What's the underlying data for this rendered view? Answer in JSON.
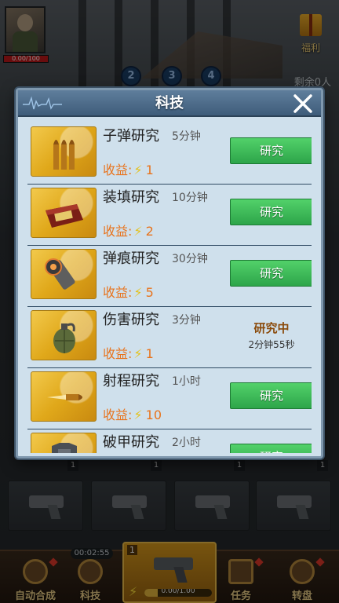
{
  "hud": {
    "hp_text": "0.00/100",
    "gift_label": "福利",
    "waves": [
      "2",
      "3",
      "4"
    ],
    "remain_text": "剩余0人"
  },
  "bottom": {
    "slot_counts": [
      "1",
      "1",
      "1",
      "1"
    ],
    "timer": "00:02:55",
    "center_slot_num": "1",
    "center_progress_text": "0.00/1.00",
    "center_progress": 0.2,
    "nav": [
      "自动合成",
      "科技",
      "任务",
      "转盘"
    ]
  },
  "modal": {
    "title": "科技",
    "rows": [
      {
        "name": "子弹研究",
        "time": "5分钟",
        "yield_label": "收益:",
        "yield_value": "1",
        "action": "研究"
      },
      {
        "name": "装填研究",
        "time": "10分钟",
        "yield_label": "收益:",
        "yield_value": "2",
        "action": "研究"
      },
      {
        "name": "弹痕研究",
        "time": "30分钟",
        "yield_label": "收益:",
        "yield_value": "5",
        "action": "研究"
      },
      {
        "name": "伤害研究",
        "time": "3分钟",
        "yield_label": "收益:",
        "yield_value": "1",
        "status": "研究中",
        "remaining": "2分钟55秒"
      },
      {
        "name": "射程研究",
        "time": "1小时",
        "yield_label": "收益:",
        "yield_value": "10",
        "action": "研究"
      },
      {
        "name": "破甲研究",
        "time": "2小时",
        "action": "研究"
      }
    ]
  },
  "colors": {
    "button_green": "#3cc05a",
    "yield_orange": "#e8731c",
    "header_blue": "#4a6a8a"
  }
}
